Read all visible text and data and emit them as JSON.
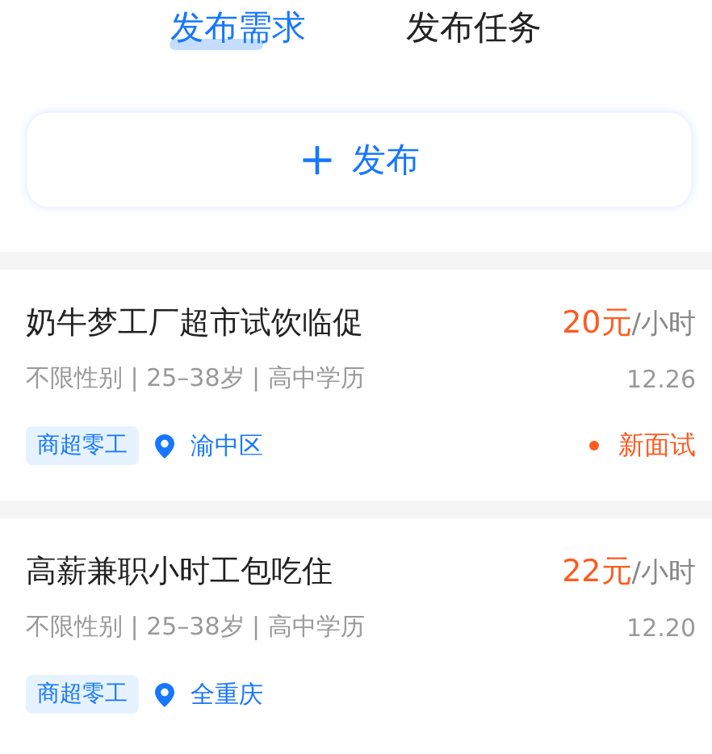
{
  "tabs": [
    {
      "label": "发布需求",
      "selected": true
    },
    {
      "label": "发布任务",
      "selected": false
    }
  ],
  "publish_button": {
    "icon": "+",
    "label": "发布"
  },
  "jobs": [
    {
      "title": "奶牛梦工厂超市试饮临促",
      "price": "20元",
      "unit": "/小时",
      "meta": "不限性别 | 25–38岁 | 高中学历",
      "date": "12.26",
      "tag": "商超零工",
      "location": "渝中区",
      "status": "新面试"
    },
    {
      "title": "高薪兼职小时工包吃住",
      "price": "22元",
      "unit": "/小时",
      "meta": "不限性别 | 25–38岁 | 高中学历",
      "date": "12.20",
      "tag": "商超零工",
      "location": "全重庆"
    }
  ]
}
